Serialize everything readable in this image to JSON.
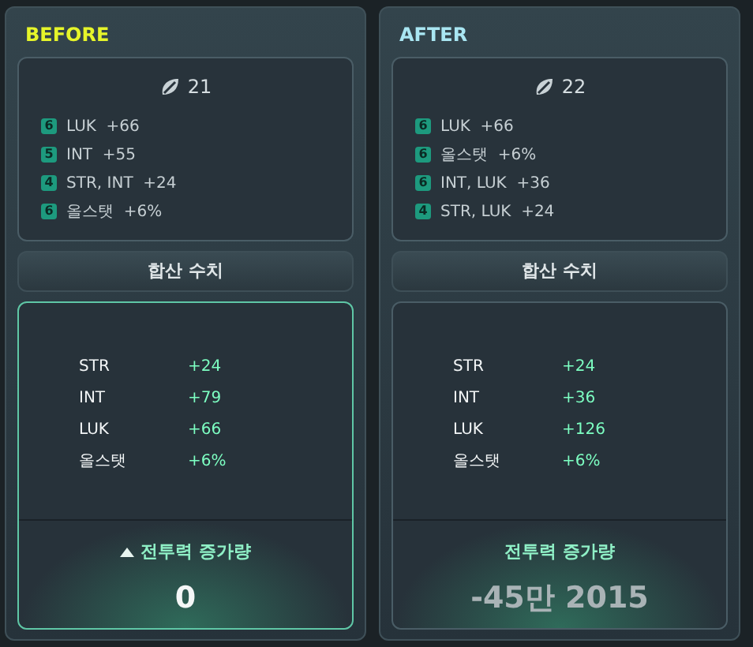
{
  "panels": [
    {
      "title": "BEFORE",
      "selected": true,
      "potential": "21",
      "options": [
        {
          "grade": "6",
          "text": "LUK  +66"
        },
        {
          "grade": "5",
          "text": "INT  +55"
        },
        {
          "grade": "4",
          "text": "STR, INT  +24"
        },
        {
          "grade": "6",
          "text": "올스탯  +6%"
        }
      ],
      "sum_button": "합산 수치",
      "stats": [
        {
          "name": "STR",
          "value": "+24"
        },
        {
          "name": "INT",
          "value": "+79"
        },
        {
          "name": "LUK",
          "value": "+66"
        },
        {
          "name": "올스탯",
          "value": "+6%"
        }
      ],
      "power_label": "전투력 증가량",
      "power_up_arrow": true,
      "power_value": "0"
    },
    {
      "title": "AFTER",
      "selected": false,
      "potential": "22",
      "options": [
        {
          "grade": "6",
          "text": "LUK  +66"
        },
        {
          "grade": "6",
          "text": "올스탯  +6%"
        },
        {
          "grade": "6",
          "text": "INT, LUK  +36"
        },
        {
          "grade": "4",
          "text": "STR, LUK  +24"
        }
      ],
      "sum_button": "합산 수치",
      "stats": [
        {
          "name": "STR",
          "value": "+24"
        },
        {
          "name": "INT",
          "value": "+36"
        },
        {
          "name": "LUK",
          "value": "+126"
        },
        {
          "name": "올스탯",
          "value": "+6%"
        }
      ],
      "power_label": "전투력 증가량",
      "power_up_arrow": false,
      "power_value": "-45만 2015"
    }
  ]
}
